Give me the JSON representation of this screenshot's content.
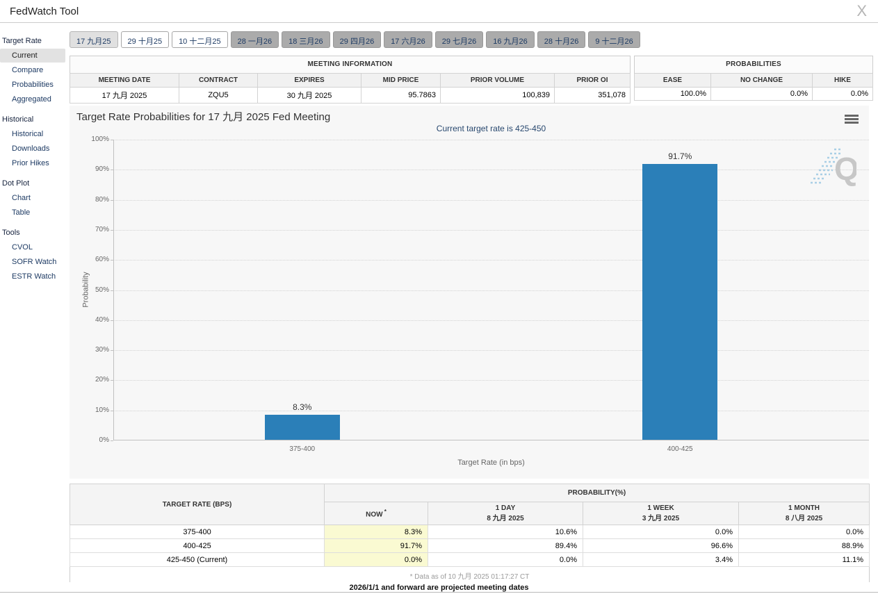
{
  "window": {
    "title": "FedWatch Tool",
    "close_glyph": "X"
  },
  "tabs": [
    {
      "label": "17 九月25",
      "state": "selected"
    },
    {
      "label": "29 十月25",
      "state": "normal"
    },
    {
      "label": "10 十二月25",
      "state": "normal"
    },
    {
      "label": "28 一月26",
      "state": "future"
    },
    {
      "label": "18 三月26",
      "state": "future"
    },
    {
      "label": "29 四月26",
      "state": "future"
    },
    {
      "label": "17 六月26",
      "state": "future"
    },
    {
      "label": "29 七月26",
      "state": "future"
    },
    {
      "label": "16 九月26",
      "state": "future"
    },
    {
      "label": "28 十月26",
      "state": "future"
    },
    {
      "label": "9 十二月26",
      "state": "future"
    }
  ],
  "sidebar": {
    "groups": [
      {
        "heading": "Target Rate",
        "items": [
          {
            "label": "Current",
            "selected": true
          },
          {
            "label": "Compare",
            "selected": false
          },
          {
            "label": "Probabilities",
            "selected": false
          },
          {
            "label": "Aggregated",
            "selected": false
          }
        ]
      },
      {
        "heading": "Historical",
        "items": [
          {
            "label": "Historical",
            "selected": false
          },
          {
            "label": "Downloads",
            "selected": false
          },
          {
            "label": "Prior Hikes",
            "selected": false
          }
        ]
      },
      {
        "heading": "Dot Plot",
        "items": [
          {
            "label": "Chart",
            "selected": false
          },
          {
            "label": "Table",
            "selected": false
          }
        ]
      },
      {
        "heading": "Tools",
        "items": [
          {
            "label": "CVOL",
            "selected": false
          },
          {
            "label": "SOFR Watch",
            "selected": false
          },
          {
            "label": "ESTR Watch",
            "selected": false
          }
        ]
      }
    ]
  },
  "meeting_information": {
    "title": "MEETING INFORMATION",
    "columns": [
      "MEETING DATE",
      "CONTRACT",
      "EXPIRES",
      "MID PRICE",
      "PRIOR VOLUME",
      "PRIOR OI"
    ],
    "row": [
      "17 九月 2025",
      "ZQU5",
      "30 九月 2025",
      "95.7863",
      "100,839",
      "351,078"
    ]
  },
  "probabilities_panel": {
    "title": "PROBABILITIES",
    "columns": [
      "EASE",
      "NO CHANGE",
      "HIKE"
    ],
    "row": [
      "100.0%",
      "0.0%",
      "0.0%"
    ]
  },
  "chart_data": {
    "type": "bar",
    "title": "Target Rate Probabilities for 17 九月 2025 Fed Meeting",
    "subtitle": "Current target rate is 425-450",
    "categories": [
      "375-400",
      "400-425"
    ],
    "values": [
      8.3,
      91.7
    ],
    "data_labels": [
      "8.3%",
      "91.7%"
    ],
    "xlabel": "Target Rate (in bps)",
    "ylabel": "Probability",
    "ylim": [
      0,
      100
    ],
    "ytick_step": 10,
    "ytick_suffix": "%",
    "bar_color": "#2b7fb8",
    "grid": "dotted horizontal",
    "legend": "none"
  },
  "probability_table": {
    "col1_header": "TARGET RATE (BPS)",
    "group_header": "PROBABILITY(%)",
    "sub_headers": [
      {
        "line1": "NOW",
        "sup": "*",
        "line2": ""
      },
      {
        "line1": "1 DAY",
        "sup": "",
        "line2": "8 九月 2025"
      },
      {
        "line1": "1 WEEK",
        "sup": "",
        "line2": "3 九月 2025"
      },
      {
        "line1": "1 MONTH",
        "sup": "",
        "line2": "8 八月 2025"
      }
    ],
    "rows": [
      {
        "rate": "375-400",
        "now": "8.3%",
        "day": "10.6%",
        "week": "0.0%",
        "month": "0.0%"
      },
      {
        "rate": "400-425",
        "now": "91.7%",
        "day": "89.4%",
        "week": "96.6%",
        "month": "88.9%"
      },
      {
        "rate": "425-450 (Current)",
        "now": "0.0%",
        "day": "0.0%",
        "week": "3.4%",
        "month": "11.1%"
      }
    ],
    "footnote": "* Data as of 10 九月 2025 01:17:27 CT"
  },
  "footer_note": "2026/1/1 and forward are projected meeting dates",
  "colors": {
    "bar_blue": "#2b7fb8",
    "now_column_yellow": "#fafad2",
    "link_navy": "#1d3a63",
    "panel_gray": "#f7f7f7",
    "future_tab_gray": "#ababab"
  }
}
